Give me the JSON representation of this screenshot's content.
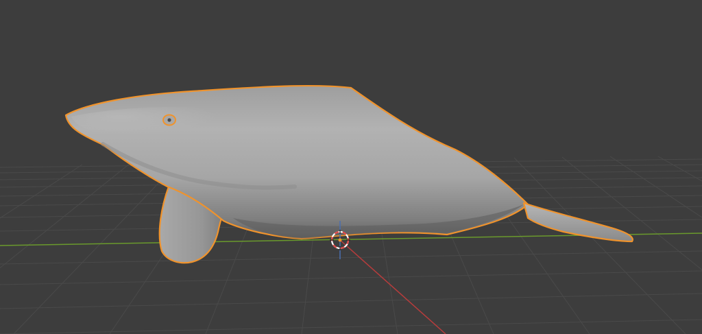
{
  "app": {
    "name": "3D Viewport"
  },
  "viewport": {
    "background_color": "#3d3d3d",
    "grid_color": "#4a4a4a",
    "x_axis_color": "#b83c3c",
    "y_axis_color": "#6a9a2c",
    "z_axis_color": "#4a6fb0",
    "view": "perspective",
    "grid_visible": true
  },
  "scene": {
    "selected_object": {
      "name": "whale",
      "type": "mesh",
      "shading": "solid",
      "selected": true,
      "outline_color": "#f0932c",
      "surface_color": "#a8a8a8"
    },
    "origin_marker": {
      "icon": "object-origin-icon"
    },
    "cursor_3d": {
      "icon": "3d-cursor-icon",
      "ring_colors": [
        "#e34747",
        "#ffffff"
      ]
    }
  }
}
